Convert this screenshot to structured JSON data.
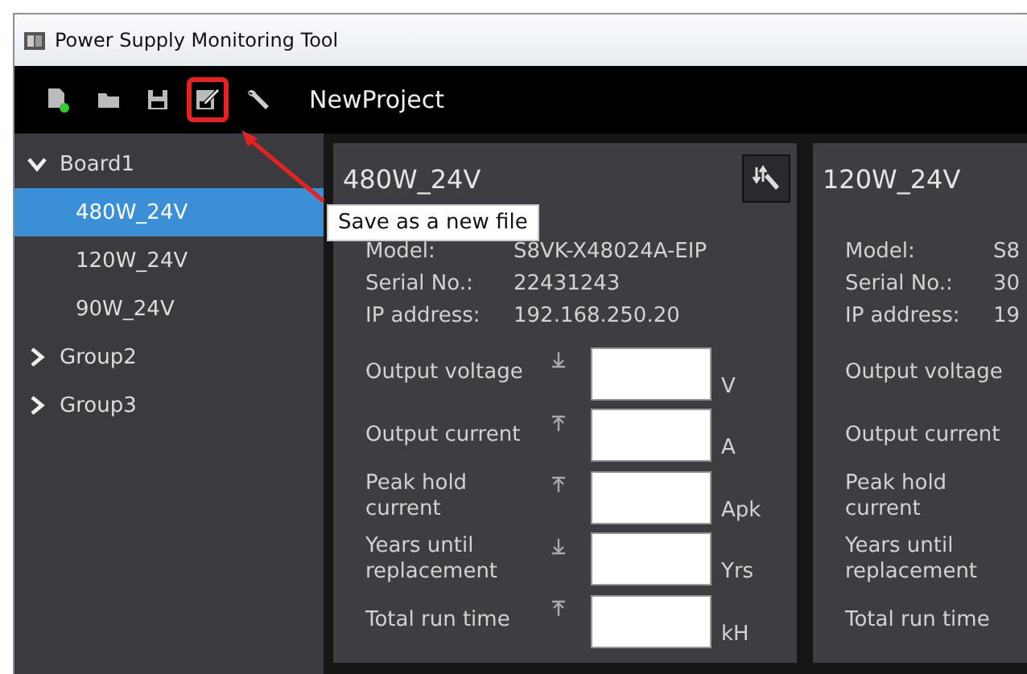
{
  "window": {
    "title": "Power Supply Monitoring Tool"
  },
  "toolbar": {
    "items": [
      {
        "kind": "new",
        "highlighted": false
      },
      {
        "kind": "open",
        "highlighted": false
      },
      {
        "kind": "save",
        "highlighted": false
      },
      {
        "kind": "save-as",
        "highlighted": true
      },
      {
        "kind": "settings",
        "highlighted": false
      }
    ],
    "project": "NewProject",
    "callout": "Save as a new file"
  },
  "sidebar": {
    "items": [
      {
        "label": "Board1",
        "expanded": true,
        "selected": false,
        "children": [
          {
            "label": "480W_24V",
            "selected": true
          },
          {
            "label": "120W_24V",
            "selected": false
          },
          {
            "label": "90W_24V",
            "selected": false
          }
        ]
      },
      {
        "label": "Group2",
        "expanded": false,
        "selected": false
      },
      {
        "label": "Group3",
        "expanded": false,
        "selected": false
      }
    ]
  },
  "cards": [
    {
      "title": "480W_24V",
      "sort_button": true,
      "info": [
        {
          "label": "Model:",
          "value": "S8VK-X48024A-EIP"
        },
        {
          "label": "Serial No.:",
          "value": "22431243"
        },
        {
          "label": "IP address:",
          "value": "192.168.250.20"
        }
      ],
      "measurements": [
        {
          "label": "Output voltage",
          "kind": "low",
          "unit": "V"
        },
        {
          "label": "Output current",
          "kind": "high",
          "unit": "A"
        },
        {
          "label": "Peak hold current",
          "kind": "high",
          "unit": "Apk"
        },
        {
          "label": "Years until replacement",
          "kind": "low",
          "unit": "Yrs"
        },
        {
          "label": "Total run time",
          "kind": "high",
          "unit": "kH"
        }
      ]
    },
    {
      "title": "120W_24V",
      "info": [
        {
          "label": "Model:",
          "value": "S8"
        },
        {
          "label": "Serial No.:",
          "value": "30"
        },
        {
          "label": "IP address:",
          "value": "19"
        }
      ],
      "measurements": [
        {
          "label": "Output voltage"
        },
        {
          "label": "Output current"
        },
        {
          "label": "Peak hold current"
        },
        {
          "label": "Years until replacement"
        },
        {
          "label": "Total run time"
        }
      ]
    }
  ]
}
